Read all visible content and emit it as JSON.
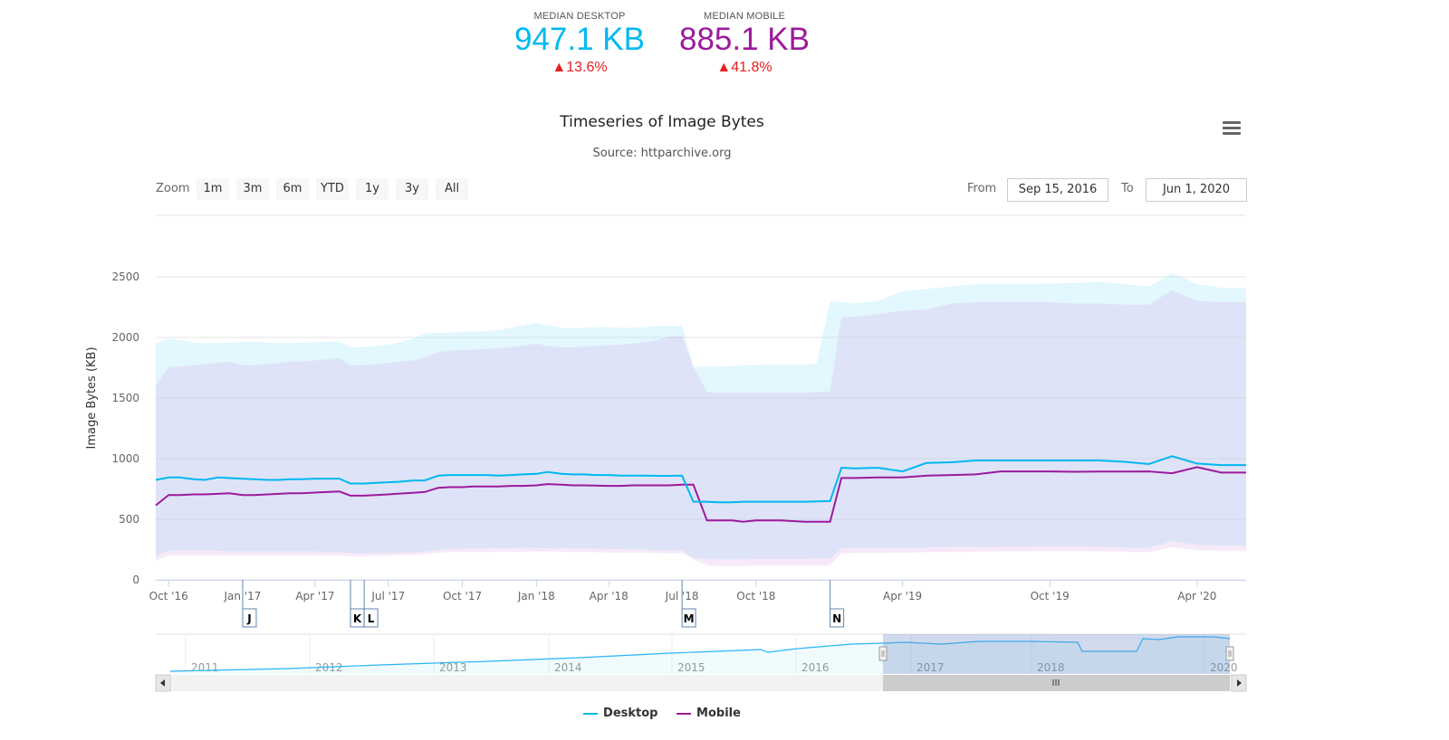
{
  "kpis": [
    {
      "label": "MEDIAN DESKTOP",
      "value": "947.1 KB",
      "change": "▲13.6%",
      "color": "#00b8f0"
    },
    {
      "label": "MEDIAN MOBILE",
      "value": "885.1 KB",
      "change": "▲41.8%",
      "color": "#9c1a9c"
    }
  ],
  "range_selector": {
    "zoom_label": "Zoom",
    "buttons": [
      "1m",
      "3m",
      "6m",
      "YTD",
      "1y",
      "3y",
      "All"
    ],
    "from_label": "From",
    "from_value": "Sep 15, 2016",
    "to_label": "To",
    "to_value": "Jun 1, 2020"
  },
  "menu": {
    "icon": "hamburger-menu-icon"
  },
  "chart_data": {
    "type": "line",
    "title": "Timeseries of Image Bytes",
    "subtitle": "Source: httparchive.org",
    "ylabel": "Image Bytes (KB)",
    "xlabel": "",
    "ylim": [
      0,
      2500
    ],
    "yticks": [
      0,
      500,
      1000,
      1500,
      2000,
      2500
    ],
    "xlim": [
      "2016-09-15",
      "2020-06-01"
    ],
    "xticks": [
      {
        "date": "2016-10-01",
        "label": "Oct '16"
      },
      {
        "date": "2017-01-01",
        "label": "Jan '17"
      },
      {
        "date": "2017-04-01",
        "label": "Apr '17"
      },
      {
        "date": "2017-07-01",
        "label": "Jul '17"
      },
      {
        "date": "2017-10-01",
        "label": "Oct '17"
      },
      {
        "date": "2018-01-01",
        "label": "Jan '18"
      },
      {
        "date": "2018-04-01",
        "label": "Apr '18"
      },
      {
        "date": "2018-07-01",
        "label": "Jul '18"
      },
      {
        "date": "2018-10-01",
        "label": "Oct '18"
      },
      {
        "date": "2019-04-01",
        "label": "Apr '19"
      },
      {
        "date": "2019-10-01",
        "label": "Oct '19"
      },
      {
        "date": "2020-04-01",
        "label": "Apr '20"
      }
    ],
    "grid": true,
    "legend": "bottom-center",
    "flags": [
      {
        "date": "2017-01-01",
        "label": "J"
      },
      {
        "date": "2017-05-15",
        "label": "K"
      },
      {
        "date": "2017-06-01",
        "label": "L"
      },
      {
        "date": "2018-07-01",
        "label": "M"
      },
      {
        "date": "2019-01-01",
        "label": "N"
      }
    ],
    "x": [
      "2016-09-15",
      "2016-10-01",
      "2016-10-15",
      "2016-11-01",
      "2016-11-15",
      "2016-12-01",
      "2016-12-15",
      "2017-01-01",
      "2017-01-15",
      "2017-02-01",
      "2017-02-15",
      "2017-03-01",
      "2017-03-15",
      "2017-04-01",
      "2017-04-15",
      "2017-05-01",
      "2017-05-15",
      "2017-06-01",
      "2017-06-15",
      "2017-07-01",
      "2017-07-15",
      "2017-08-01",
      "2017-08-15",
      "2017-09-01",
      "2017-09-15",
      "2017-10-01",
      "2017-10-15",
      "2017-11-01",
      "2017-11-15",
      "2017-12-01",
      "2017-12-15",
      "2018-01-01",
      "2018-01-15",
      "2018-02-01",
      "2018-02-15",
      "2018-03-01",
      "2018-03-15",
      "2018-04-01",
      "2018-04-15",
      "2018-05-01",
      "2018-05-15",
      "2018-06-01",
      "2018-06-15",
      "2018-07-01",
      "2018-07-15",
      "2018-08-01",
      "2018-08-15",
      "2018-09-01",
      "2018-09-15",
      "2018-10-01",
      "2018-10-15",
      "2018-11-01",
      "2018-11-15",
      "2018-12-01",
      "2018-12-15",
      "2019-01-01",
      "2019-01-15",
      "2019-02-01",
      "2019-03-01",
      "2019-04-01",
      "2019-05-01",
      "2019-06-01",
      "2019-07-01",
      "2019-08-01",
      "2019-09-01",
      "2019-10-01",
      "2019-11-01",
      "2019-12-01",
      "2020-01-01",
      "2020-02-01",
      "2020-03-01",
      "2020-04-01",
      "2020-05-01",
      "2020-06-01"
    ],
    "series": [
      {
        "name": "Desktop",
        "color": "#00b8f0",
        "values": [
          825,
          845,
          845,
          830,
          825,
          845,
          840,
          835,
          830,
          825,
          825,
          830,
          830,
          835,
          835,
          835,
          795,
          795,
          800,
          805,
          810,
          820,
          820,
          860,
          865,
          865,
          865,
          865,
          860,
          865,
          870,
          875,
          890,
          875,
          870,
          870,
          865,
          865,
          860,
          860,
          860,
          858,
          858,
          860,
          645,
          645,
          640,
          640,
          645,
          645,
          645,
          645,
          645,
          645,
          648,
          650,
          925,
          920,
          925,
          895,
          965,
          970,
          985,
          985,
          985,
          985,
          985,
          985,
          975,
          955,
          1020,
          960,
          947,
          947
        ],
        "band_high": [
          1950,
          1990,
          1980,
          1960,
          1950,
          1955,
          1960,
          1960,
          1965,
          1960,
          1950,
          1955,
          1960,
          1960,
          1965,
          1965,
          1920,
          1920,
          1930,
          1940,
          1960,
          1990,
          2030,
          2040,
          2040,
          2045,
          2050,
          2050,
          2060,
          2080,
          2100,
          2120,
          2100,
          2080,
          2075,
          2080,
          2085,
          2085,
          2080,
          2080,
          2085,
          2095,
          2095,
          2095,
          1760,
          1760,
          1760,
          1765,
          1770,
          1770,
          1775,
          1775,
          1775,
          1775,
          1780,
          2300,
          2290,
          2280,
          2300,
          2380,
          2400,
          2420,
          2440,
          2440,
          2440,
          2445,
          2450,
          2460,
          2440,
          2420,
          2530,
          2440,
          2410,
          2405
        ],
        "band_low": [
          200,
          240,
          240,
          240,
          240,
          240,
          235,
          235,
          235,
          235,
          235,
          235,
          235,
          235,
          230,
          230,
          220,
          220,
          220,
          222,
          225,
          228,
          232,
          250,
          255,
          258,
          260,
          260,
          262,
          262,
          265,
          265,
          262,
          262,
          260,
          258,
          258,
          255,
          255,
          250,
          250,
          245,
          245,
          245,
          180,
          170,
          170,
          170,
          170,
          172,
          172,
          172,
          172,
          172,
          175,
          178,
          260,
          262,
          262,
          262,
          268,
          270,
          270,
          272,
          275,
          275,
          275,
          272,
          268,
          265,
          320,
          290,
          282,
          280
        ]
      },
      {
        "name": "Mobile",
        "color": "#9c1a9c",
        "values": [
          615,
          700,
          700,
          705,
          705,
          710,
          715,
          700,
          700,
          705,
          710,
          715,
          715,
          720,
          725,
          730,
          695,
          695,
          700,
          705,
          712,
          718,
          725,
          760,
          765,
          765,
          770,
          770,
          770,
          775,
          775,
          780,
          790,
          785,
          780,
          780,
          778,
          775,
          775,
          780,
          780,
          780,
          780,
          785,
          785,
          490,
          490,
          490,
          480,
          490,
          490,
          490,
          485,
          480,
          480,
          480,
          840,
          840,
          845,
          845,
          860,
          865,
          870,
          895,
          895,
          895,
          892,
          893,
          893,
          895,
          880,
          930,
          885,
          885
        ],
        "band_high": [
          1600,
          1760,
          1760,
          1770,
          1780,
          1790,
          1800,
          1770,
          1770,
          1780,
          1790,
          1800,
          1800,
          1810,
          1820,
          1830,
          1770,
          1770,
          1780,
          1790,
          1800,
          1810,
          1830,
          1880,
          1890,
          1895,
          1900,
          1905,
          1910,
          1920,
          1930,
          1950,
          1930,
          1920,
          1920,
          1925,
          1930,
          1935,
          1940,
          1950,
          1960,
          1980,
          2010,
          2010,
          1760,
          1550,
          1545,
          1545,
          1545,
          1545,
          1545,
          1545,
          1545,
          1545,
          1550,
          1555,
          2170,
          2170,
          2190,
          2220,
          2230,
          2280,
          2290,
          2290,
          2290,
          2290,
          2280,
          2280,
          2270,
          2270,
          2390,
          2300,
          2290,
          2290
        ],
        "band_low": [
          160,
          200,
          200,
          200,
          200,
          200,
          200,
          200,
          200,
          200,
          200,
          200,
          200,
          200,
          200,
          200,
          195,
          195,
          198,
          200,
          202,
          205,
          210,
          225,
          228,
          230,
          230,
          230,
          232,
          232,
          232,
          235,
          235,
          232,
          230,
          228,
          228,
          226,
          225,
          225,
          225,
          220,
          220,
          220,
          170,
          120,
          115,
          115,
          115,
          118,
          118,
          118,
          118,
          118,
          118,
          120,
          220,
          222,
          222,
          225,
          228,
          230,
          232,
          235,
          235,
          238,
          238,
          235,
          232,
          228,
          270,
          245,
          240,
          240
        ]
      }
    ],
    "navigator": {
      "xticks": [
        "2011",
        "2012",
        "2013",
        "2014",
        "2015",
        "2016",
        "2017",
        "2018",
        "2020"
      ],
      "selected_range": [
        "2016-09-15",
        "2020-06-01"
      ]
    }
  }
}
